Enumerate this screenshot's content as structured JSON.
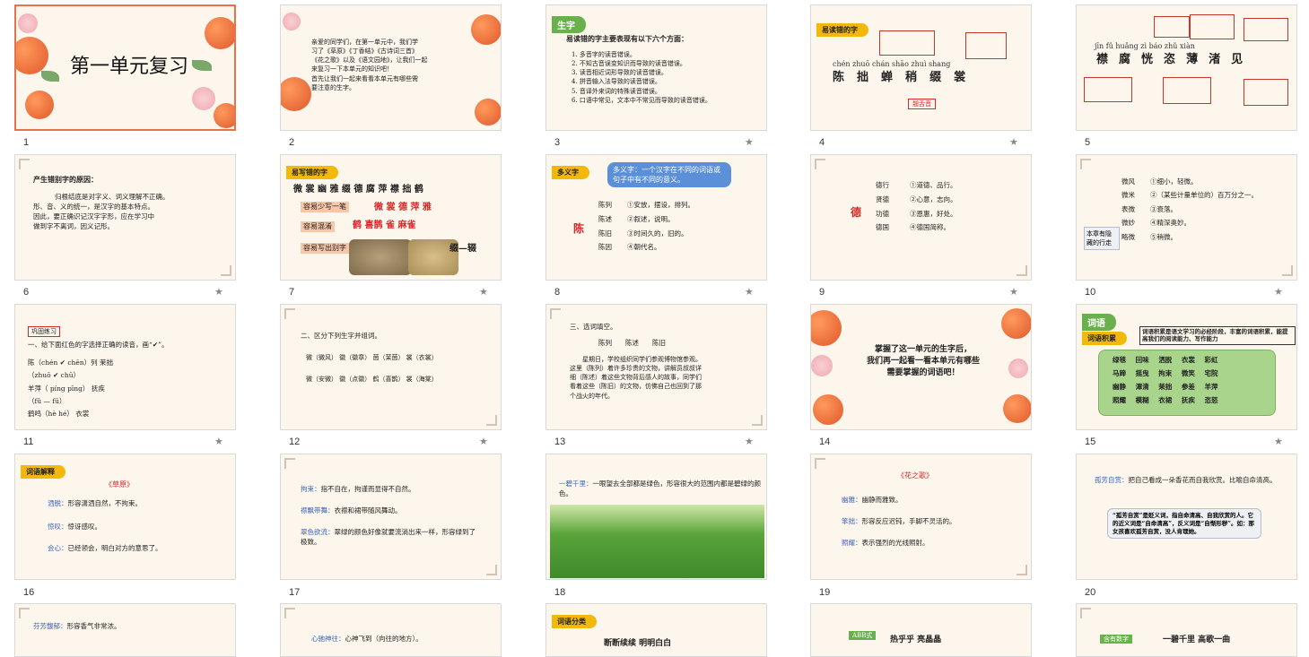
{
  "thumbnails": [
    {
      "num": "1",
      "title": "第一单元复习"
    },
    {
      "num": "2",
      "lines": [
        "亲爱的同学们，在第一单元中，我们学",
        "习了《草原》《丁香结》《古诗词三首》",
        "《花之歌》以及《语文园地》，让我们一起",
        "来复习一下本单元的知识吧！",
        "首先让我们一起来看看本单元有哪些需",
        "要注意的生字。"
      ]
    },
    {
      "num": "3",
      "tag": "生字",
      "heading": "易读错的字主要表现有以下六个方面：",
      "lines": [
        "1. 多音字的读音错误。",
        "2. 不知古音误变知识而导致的读音错误。",
        "3. 读音相近词形导致的读音错误。",
        "4. 拼音输入法导致的读音错误。",
        "5. 音译外来词的特殊读音错误。",
        "6. 口语中常见，文本中不常见而导致的读音错误。"
      ]
    },
    {
      "num": "4",
      "tag": "易读错的字",
      "chars": [
        "陈",
        "拙",
        "蝉",
        "稍",
        "缀",
        "裳"
      ],
      "note": "翘舌音"
    },
    {
      "num": "5",
      "chars": [
        "襟",
        "腐",
        "恍",
        "恣",
        "薄",
        "渚",
        "见"
      ]
    },
    {
      "num": "6",
      "heading": "产生错别字的原因：",
      "lines": [
        "归根结底是对字义、词义理解不正确。",
        "形、音、义的统一，是汉字的基本特点。",
        "因此，要正确识记汉字字形，应在学习中",
        "做到字不离词，因义记形。"
      ]
    },
    {
      "num": "7",
      "tag": "易写错的字",
      "chars_line": "微 裳 幽 雅 缀 德 腐 萍 襟 拙 鹤",
      "rows": [
        {
          "label": "容易少写一笔",
          "words": "微 裳 德 萍 雅"
        },
        {
          "label": "容易混淆",
          "words": "鹤 喜鹊  雀 麻雀"
        },
        {
          "label": "容易写出别字",
          "words": "缀—辍"
        }
      ]
    },
    {
      "num": "8",
      "tag": "多义字",
      "def": "多义字：一个汉字在不同的词语或句子中有不同的意义。",
      "char": "陈",
      "words": [
        "陈列",
        "陈述",
        "陈旧",
        "陈因"
      ],
      "meanings": [
        "①安放，摆设，排列。",
        "②叙述，说明。",
        "③时间久的，旧的。",
        "④朝代名。"
      ]
    },
    {
      "num": "9",
      "char": "德",
      "words": [
        "德行",
        "贤德",
        "功德",
        "德国"
      ],
      "meanings": [
        "①道德、品行。",
        "②心意，志向。",
        "③恩惠，好处。",
        "④德国简称。"
      ]
    },
    {
      "num": "10",
      "label": "本章有隐藏的行走",
      "words": [
        "微风",
        "微米",
        "表微",
        "微妙",
        "略微"
      ],
      "meanings": [
        "①细小，轻微。",
        "②（某些计量单位的）百万分之一。",
        "③衰落。",
        "④精深奥妙。",
        "⑤稍微。"
      ]
    },
    {
      "num": "11",
      "tag": "巩固练习",
      "heading": "一、给下面红色的字选择正确的读音，画“✔”。",
      "lines": [
        "陈（chén ✔ chēn）列     茉拙",
        "（zhuō ✔ chū）",
        "羊萍（ píng   pīng）     抚疾",
        "（fǔ —  fū）",
        "鹤鸣（hè   hé）     衣裳"
      ]
    },
    {
      "num": "12",
      "heading": "二、区分下列生字并组词。",
      "rows": [
        "微（微风）  徽（徽章）  茵（茉茵）  裳（衣裳）",
        "微（安微）  徽（点徽）  鹤（喜鹊）  裳（海棠）"
      ]
    },
    {
      "num": "13",
      "heading": "三、选词填空。",
      "options": "陈列　　陈述　　陈旧",
      "lines": [
        "星期日，学校组织同学们参观博物馆参观。",
        "这里（陈列）着许多珍贵的文物，讲解员叔叔详",
        "细（陈述）着这些文物背后感人的故事，同学们",
        "看着这些（陈旧）的文物，仿佛自己也回到了那",
        "个战火的年代。"
      ]
    },
    {
      "num": "14",
      "lines": [
        "掌握了这一单元的生字后，",
        "我们再一起看一看本单元有哪些",
        "需要掌握的词语吧！"
      ]
    },
    {
      "num": "15",
      "tag": "词语",
      "subtag": "词语积累",
      "note": "词语积累是语文学习的必经阶段，丰富的词语积累，能提高我们的阅读能力、写作能力",
      "words": [
        "绿毯",
        "回味",
        "洒脱",
        "衣裳",
        "彩虹",
        "马蹄",
        "摇曳",
        "拘束",
        "微笑",
        "宅院",
        "幽静",
        "潭清",
        "茉拙",
        "参差",
        "羊萍",
        "照耀",
        "模糊",
        "衣裙",
        "抚疾",
        "恣怒"
      ]
    },
    {
      "num": "16",
      "tag": "词语解释",
      "title": "《草原》",
      "items": [
        {
          "k": "洒脱：",
          "v": "形容潇洒自然，不拘束。"
        },
        {
          "k": "惊叹：",
          "v": "惊讶感叹。"
        },
        {
          "k": "会心：",
          "v": "已经领会，明白对方的意思了。"
        }
      ]
    },
    {
      "num": "17",
      "items": [
        {
          "k": "拘束：",
          "v": "指不自在，拘谨而显得不自然。"
        },
        {
          "k": "襟飘带舞：",
          "v": "衣襟和裙带随风舞动。"
        },
        {
          "k": "翠色欲流：",
          "v": "翠绿的颜色好像就要流淌出来一样，形容绿到了极致。"
        }
      ]
    },
    {
      "num": "18",
      "items": [
        {
          "k": "一碧千里：",
          "v": "一眼望去全部都是绿色，形容很大的范围内都是碧绿的颜色。"
        }
      ]
    },
    {
      "num": "19",
      "title": "《花之歌》",
      "items": [
        {
          "k": "幽雅：",
          "v": "幽静而雅致。"
        },
        {
          "k": "笨拙：",
          "v": "形容反应迟钝，手脚不灵活的。"
        },
        {
          "k": "照耀：",
          "v": "表示强烈的光线照射。"
        }
      ]
    },
    {
      "num": "20",
      "items": [
        {
          "k": "孤芳自赏：",
          "v": "把自己看成一朵香花而自我欣赏。比喻自命清高。"
        }
      ],
      "note": "“孤芳自赏”是贬义词，指自命清高、自我欣赏的人。它的近义词是“自命清高”，反义词是“自惭形秽”。如：那女孩喜欢孤芳自赏，没人肯理她。"
    },
    {
      "num": "21",
      "items": [
        {
          "k": "芬芳馥郁：",
          "v": "形容香气非常浓。"
        }
      ]
    },
    {
      "num": "22",
      "items": [
        {
          "k": "心驰神往：",
          "v": "心神飞到（向往的地方）。"
        }
      ]
    },
    {
      "num": "23",
      "tag": "词语分类",
      "words": "断断续续   明明白白"
    },
    {
      "num": "24",
      "tag": "ABB式",
      "words": "热乎乎   亮晶晶"
    },
    {
      "num": "25",
      "tag": "含有数字",
      "words": "一碧千里   高歌一曲"
    }
  ],
  "colors": {
    "accent": "#e8734a",
    "red": "#d42a2a",
    "blue": "#3b64b8",
    "tag": "#f2b80b"
  }
}
